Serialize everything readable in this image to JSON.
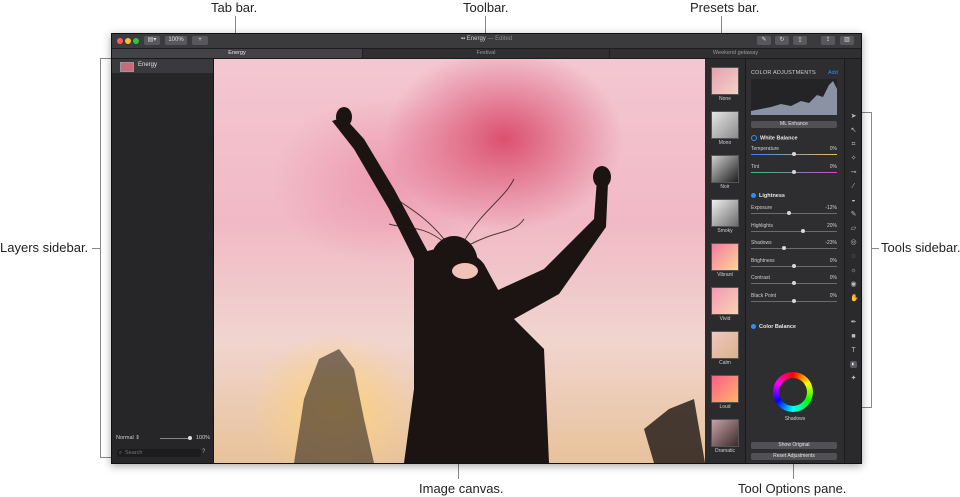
{
  "callouts": {
    "tab_bar": "Tab bar.",
    "toolbar": "Toolbar.",
    "presets_bar": "Presets bar.",
    "layers_sidebar": "Layers sidebar.",
    "tools_sidebar": "Tools sidebar.",
    "image_canvas": "Image canvas.",
    "tool_options_pane": "Tool Options pane."
  },
  "window": {
    "title": "Energy",
    "title_suffix": "— Edited",
    "zoom": "100%",
    "add_symbol": "+",
    "traffic_colors": [
      "#ff5f57",
      "#febc2e",
      "#28c840"
    ]
  },
  "tabs": [
    {
      "label": "Energy",
      "active": true
    },
    {
      "label": "Festival",
      "active": false
    },
    {
      "label": "Weekend getaway",
      "active": false
    }
  ],
  "layers": {
    "items": [
      {
        "name": "Energy"
      }
    ],
    "blend_mode": "Normal",
    "opacity": "100%",
    "search_placeholder": "Search"
  },
  "presets": [
    {
      "label": "None",
      "colors": [
        "#e7a0b0",
        "#f3d2c7"
      ]
    },
    {
      "label": "Mono",
      "colors": [
        "#e6e6e6",
        "#8a8a8a"
      ]
    },
    {
      "label": "Noir",
      "colors": [
        "#cfcfcf",
        "#1e1e1e"
      ]
    },
    {
      "label": "Smoky",
      "colors": [
        "#f0f0f0",
        "#6a6a6a"
      ]
    },
    {
      "label": "Vibrant",
      "colors": [
        "#f27ca0",
        "#ffd59a"
      ]
    },
    {
      "label": "Vivid",
      "colors": [
        "#f598b6",
        "#f7d3b2"
      ]
    },
    {
      "label": "Calm",
      "colors": [
        "#f1c6c0",
        "#d9b38a"
      ]
    },
    {
      "label": "Loud",
      "colors": [
        "#ff5e88",
        "#ffb36a"
      ]
    },
    {
      "label": "Dramatic",
      "colors": [
        "#c7a2a8",
        "#3b2b2b"
      ]
    }
  ],
  "options": {
    "title": "COLOR ADJUSTMENTS",
    "add": "Add",
    "ml_enhance": "ML Enhance",
    "white_balance": {
      "title": "White Balance",
      "color": "#2f8cff",
      "params": [
        {
          "label": "Temperature",
          "value": "0%",
          "pos": 0.5,
          "track": "temp"
        },
        {
          "label": "Tint",
          "value": "0%",
          "pos": 0.5,
          "track": "tint"
        }
      ]
    },
    "lightness": {
      "title": "Lightness",
      "color": "#2f8cff",
      "params": [
        {
          "label": "Exposure",
          "value": "-12%",
          "pos": 0.44
        },
        {
          "label": "Highlights",
          "value": "20%",
          "pos": 0.6
        },
        {
          "label": "Shadows",
          "value": "-23%",
          "pos": 0.38
        },
        {
          "label": "Brightness",
          "value": "0%",
          "pos": 0.5
        },
        {
          "label": "Contrast",
          "value": "0%",
          "pos": 0.5
        },
        {
          "label": "Black Point",
          "value": "0%",
          "pos": 0.5
        }
      ]
    },
    "color_balance": {
      "title": "Color Balance",
      "color": "#2f8cff",
      "wheel_label": "Shadows"
    },
    "show_original": "Show Original",
    "reset_adjustments": "Reset Adjustments"
  },
  "tools": {
    "icons": [
      "arrow-icon",
      "select-icon",
      "crop-icon",
      "wand-icon",
      "eyedropper-icon",
      "brush-icon",
      "bucket-icon",
      "pencil-icon",
      "eraser-icon",
      "clone-icon",
      "blur-icon",
      "sun-icon",
      "red-eye-icon",
      "hand-icon",
      "pen-icon",
      "shape-icon",
      "text-icon",
      "color-adjust-icon",
      "magic-icon"
    ]
  }
}
